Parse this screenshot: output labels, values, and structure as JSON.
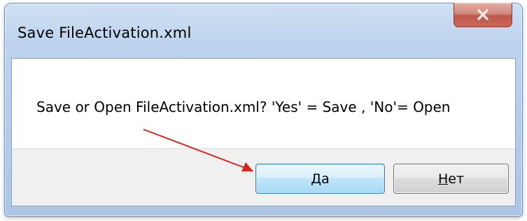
{
  "dialog": {
    "title": "Save FileActivation.xml",
    "message": "Save or Open FileActivation.xml? 'Yes' = Save , 'No'= Open",
    "yes_button": {
      "mnemonic": "Д",
      "rest": "а"
    },
    "no_button": {
      "mnemonic": "Н",
      "rest": "ет"
    }
  },
  "colors": {
    "annotation_arrow": "#d9261c",
    "close_button": "#c8685a",
    "focused_button_border": "#3c7fb1"
  },
  "icons": {
    "close": "close-icon",
    "annotation": "red-arrow-annotation"
  }
}
